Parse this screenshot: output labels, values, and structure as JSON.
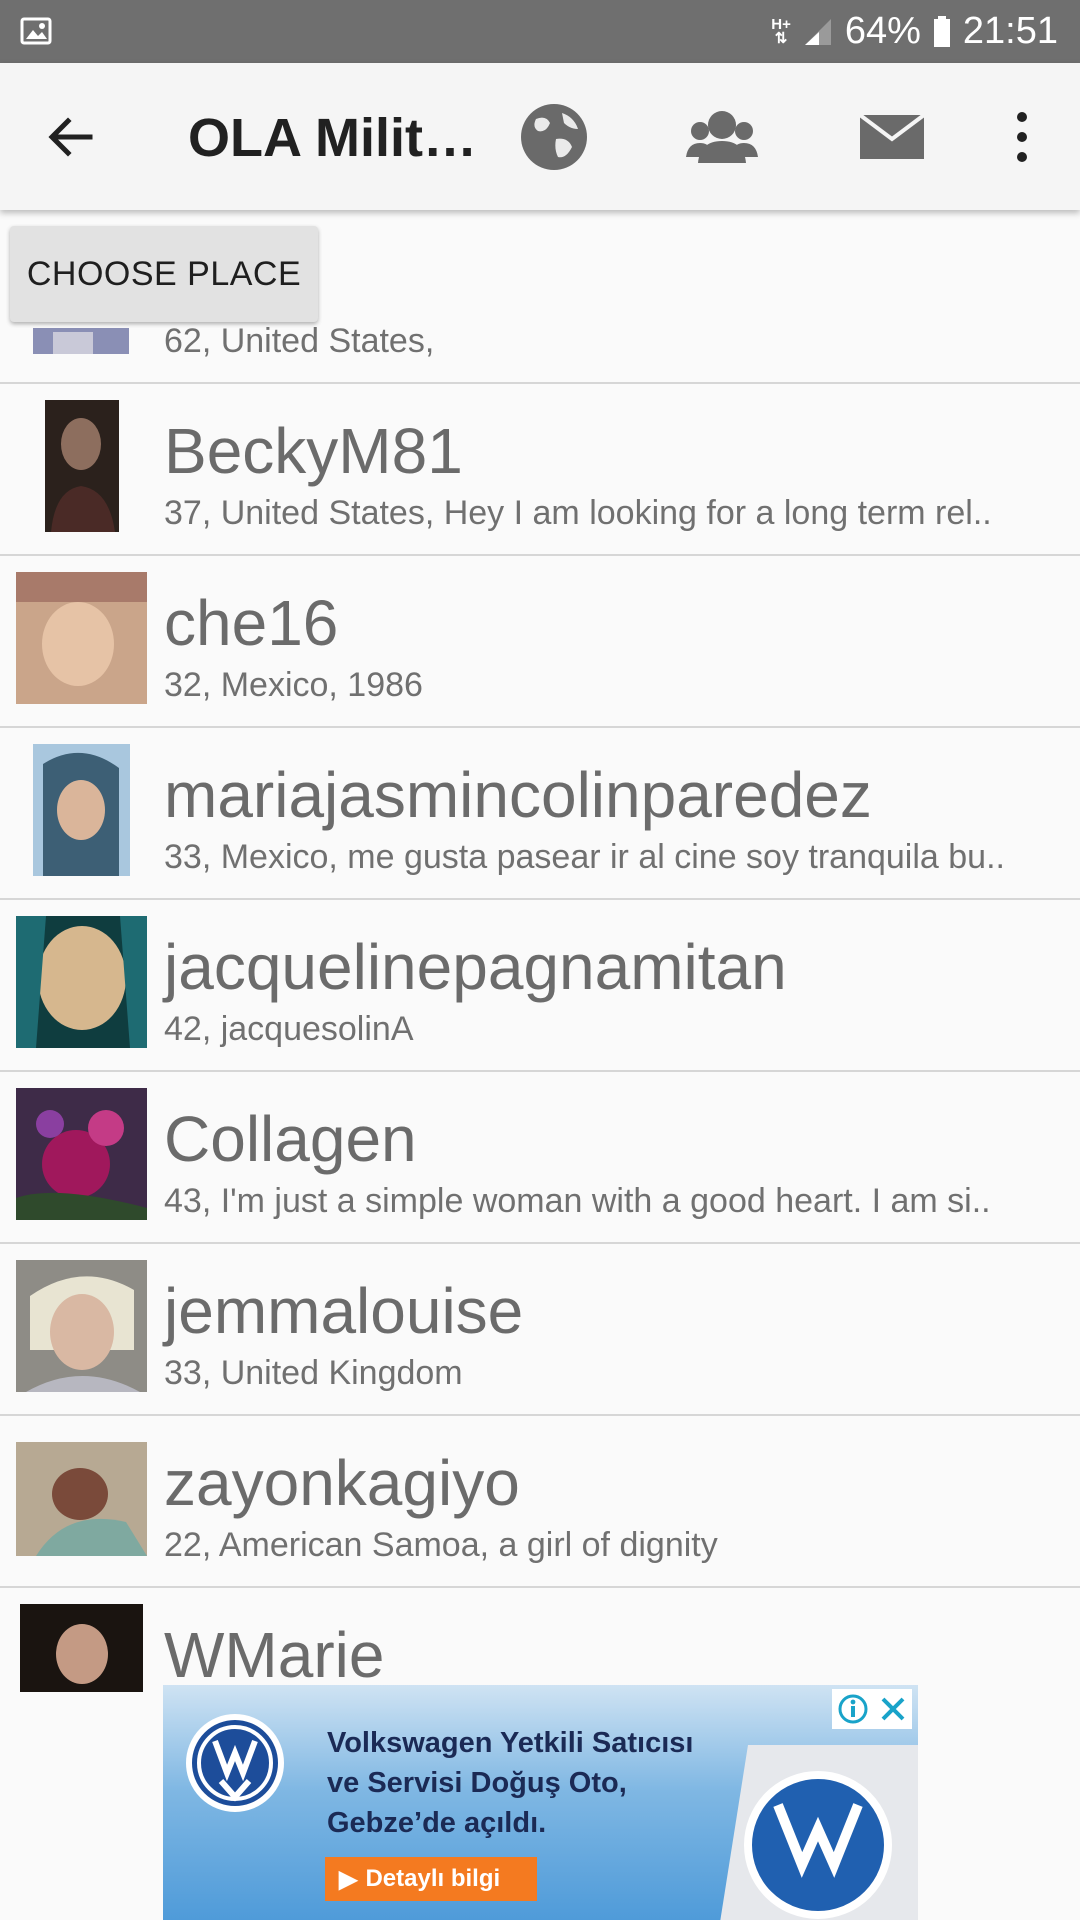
{
  "status_bar": {
    "network": "H+",
    "battery": "64%",
    "time": "21:51"
  },
  "toolbar": {
    "title": "OLA Milit…"
  },
  "choose_place_label": "CHOOSE PLACE",
  "list": [
    {
      "name": "",
      "info": "62, United States,"
    },
    {
      "name": "BeckyM81",
      "info": "37, United States, Hey I am looking for a long term rel.."
    },
    {
      "name": "che16",
      "info": "32, Mexico, 1986"
    },
    {
      "name": "mariajasmincolinparedez",
      "info": "33, Mexico, me gusta pasear ir al cine soy tranquila bu.."
    },
    {
      "name": "jacquelinepagnamitan",
      "info": "42,  jacquesolinA"
    },
    {
      "name": "Collagen",
      "info": "43, I'm just a simple woman with a good heart. I am si.."
    },
    {
      "name": "jemmalouise",
      "info": "33, United Kingdom"
    },
    {
      "name": "zayonkagiyo",
      "info": "22, American Samoa, a girl of dignity"
    },
    {
      "name": "WMarie",
      "info": ""
    }
  ],
  "ad": {
    "headline_1": "Volkswagen Yetkili Satıcısı",
    "headline_2": "ve Servisi Doğuş Oto,",
    "headline_3": "Gebze’de açıldı.",
    "cta": "Detaylı bilgi"
  },
  "colors": {
    "status_bar": "#6f6f6f",
    "toolbar": "#f5f5f5",
    "list_bg": "#fafafa",
    "cta": "#f47a20"
  }
}
